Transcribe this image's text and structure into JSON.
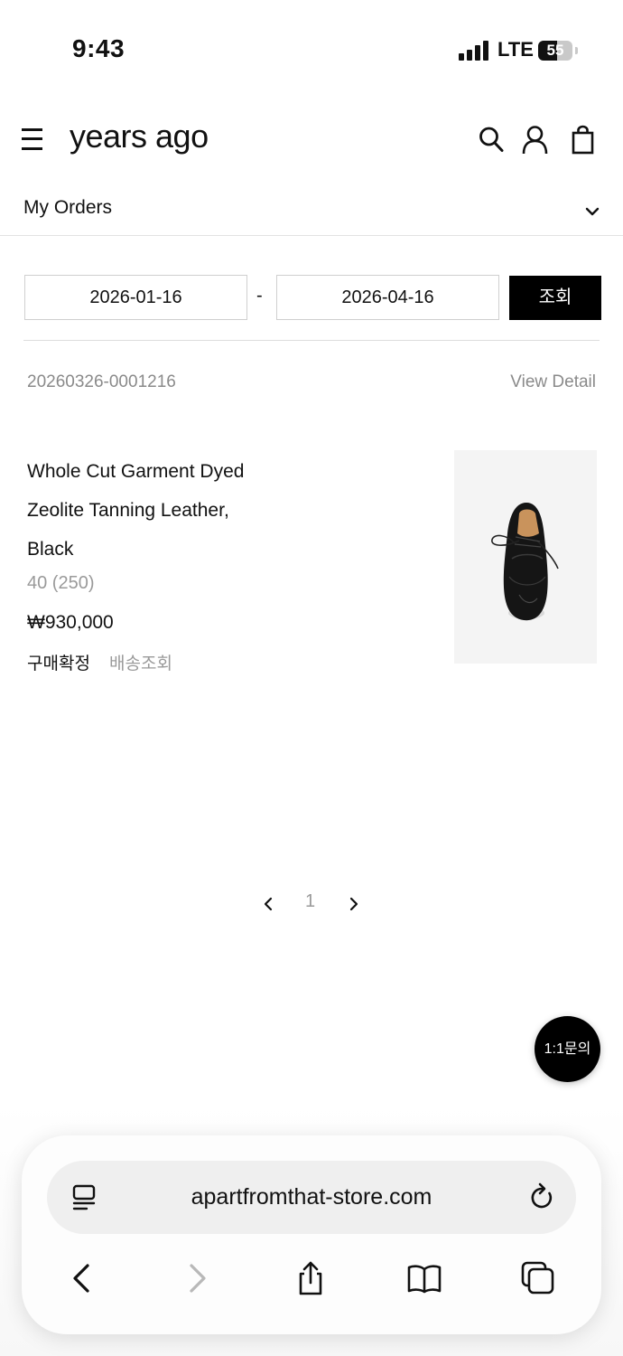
{
  "status_bar": {
    "time": "9:43",
    "network": "LTE",
    "battery": "55",
    "battery_level": 0.55
  },
  "header": {
    "brand": "years ago",
    "icons": [
      "menu-icon",
      "search-icon",
      "account-icon",
      "shopping-bag-icon"
    ]
  },
  "nav": {
    "title": "My Orders"
  },
  "filter": {
    "start_date": "2026-01-16",
    "separator": "-",
    "end_date": "2026-04-16",
    "search_label": "조회"
  },
  "order": {
    "number": "20260326-0001216",
    "detail_link": "View Detail",
    "product": {
      "name_lines": [
        "Whole Cut Garment Dyed",
        "Zeolite Tanning Leather,",
        "Black"
      ],
      "option": "40 (250)",
      "price": "₩930,000",
      "status": "구매확정",
      "track_label": "배송조회"
    }
  },
  "pagination": {
    "current": "1"
  },
  "chat": {
    "label": "1:1문의"
  },
  "browser": {
    "url": "apartfromthat-store.com",
    "icons": [
      "reader-icon",
      "reload-icon",
      "back-icon",
      "forward-icon",
      "share-icon",
      "bookmarks-icon",
      "tabs-icon"
    ]
  }
}
